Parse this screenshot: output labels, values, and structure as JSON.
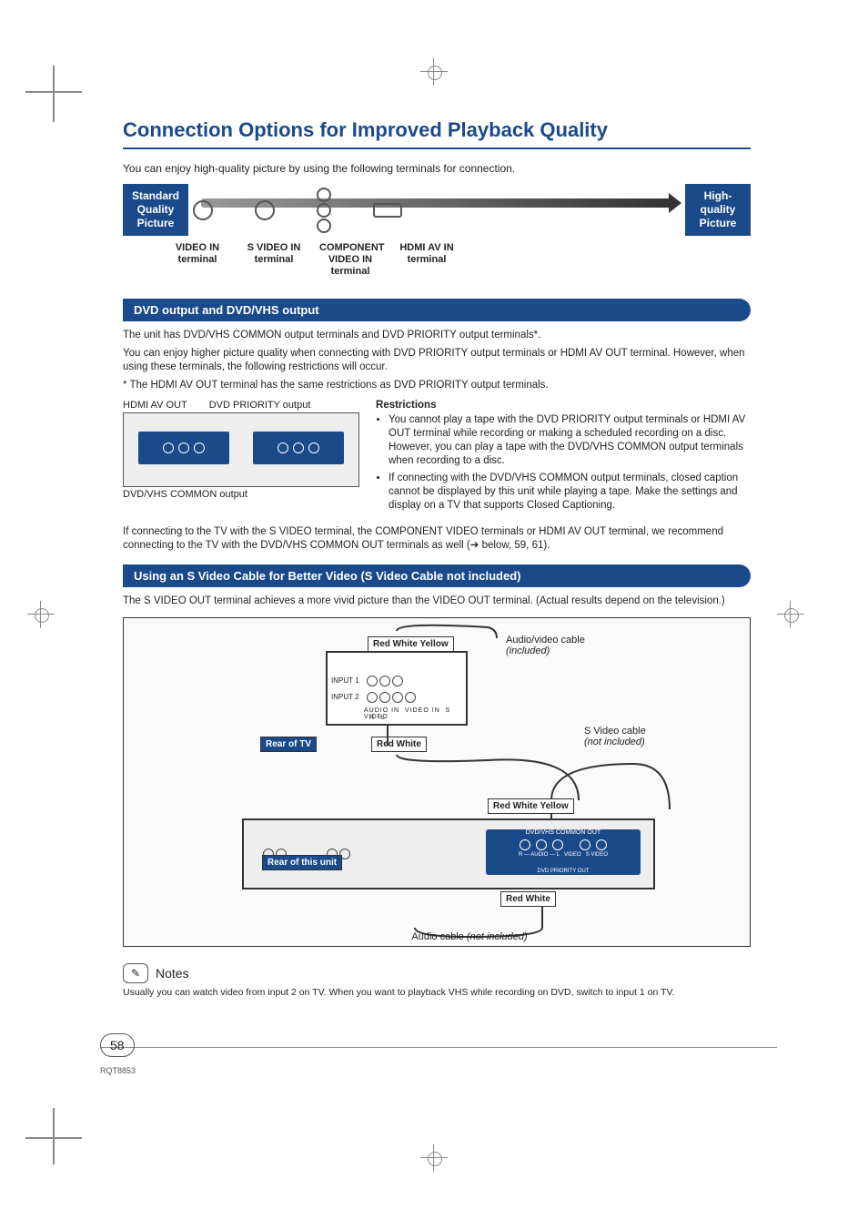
{
  "page": {
    "title": "Connection Options for Improved Playback Quality",
    "intro": "You can enjoy high-quality picture by using the following terminals for connection.",
    "page_number": "58",
    "doc_code": "RQT8853"
  },
  "quality": {
    "left_badge": "Standard Quality Picture",
    "right_badge": "High-quality Picture",
    "terminals": [
      "VIDEO IN terminal",
      "S VIDEO IN terminal",
      "COMPONENT VIDEO IN terminal",
      "HDMI AV IN terminal"
    ]
  },
  "section1": {
    "heading": "DVD output and DVD/VHS output",
    "p1": "The unit has DVD/VHS COMMON output terminals and DVD PRIORITY output terminals*.",
    "p2": "You can enjoy higher picture quality when connecting with DVD PRIORITY output terminals or HDMI AV OUT terminal. However, when using these terminals, the following restrictions will occur.",
    "p3": "* The HDMI AV OUT terminal has the same restrictions as DVD PRIORITY output terminals.",
    "cap_hdmi": "HDMI AV OUT",
    "cap_priority": "DVD PRIORITY output",
    "cap_common": "DVD/VHS COMMON output",
    "restr_title": "Restrictions",
    "restr_items": [
      "You cannot play a tape with the DVD PRIORITY output terminals or HDMI AV OUT terminal while recording or making a scheduled recording on a disc. However, you can play a tape with the DVD/VHS COMMON output terminals when recording to a disc.",
      "If connecting with the DVD/VHS COMMON output terminals, closed caption cannot be displayed by this unit while playing a tape. Make the settings and display on a TV that supports Closed Captioning."
    ],
    "p4": "If connecting to the TV with the S VIDEO terminal, the COMPONENT VIDEO terminals or HDMI AV OUT terminal, we recommend connecting to the TV with the DVD/VHS COMMON OUT terminals as well (➔ below, 59, 61)."
  },
  "section2": {
    "heading": "Using an S Video Cable for Better Video (S Video Cable not included)",
    "p1": "The S VIDEO OUT terminal achieves a more vivid picture than the VIDEO OUT terminal. (Actual results depend on the television.)",
    "labels": {
      "rwy": "Red White Yellow",
      "rw": "Red White",
      "rear_tv": "Rear of TV",
      "rear_unit": "Rear of this unit",
      "av_cable": "Audio/video cable",
      "av_inc": "(included)",
      "sv_cable": "S Video cable",
      "sv_inc": "(not included)",
      "audio_cable": "Audio cable",
      "audio_inc": "(not included)",
      "input1": "INPUT 1",
      "input2": "INPUT 2",
      "audio_in": "AUDIO IN",
      "video_in": "VIDEO IN",
      "svideo": "S VIDEO",
      "r": "R",
      "l": "L",
      "dvd_common": "DVD/VHS COMMON OUT",
      "dvd_priority": "DVD PRIORITY OUT",
      "r_audio_l": "R — AUDIO — L",
      "video": "VIDEO"
    }
  },
  "notes": {
    "title": "Notes",
    "body": "Usually you can watch video from input 2 on TV. When you want to playback VHS while recording on DVD, switch to input 1 on TV."
  }
}
